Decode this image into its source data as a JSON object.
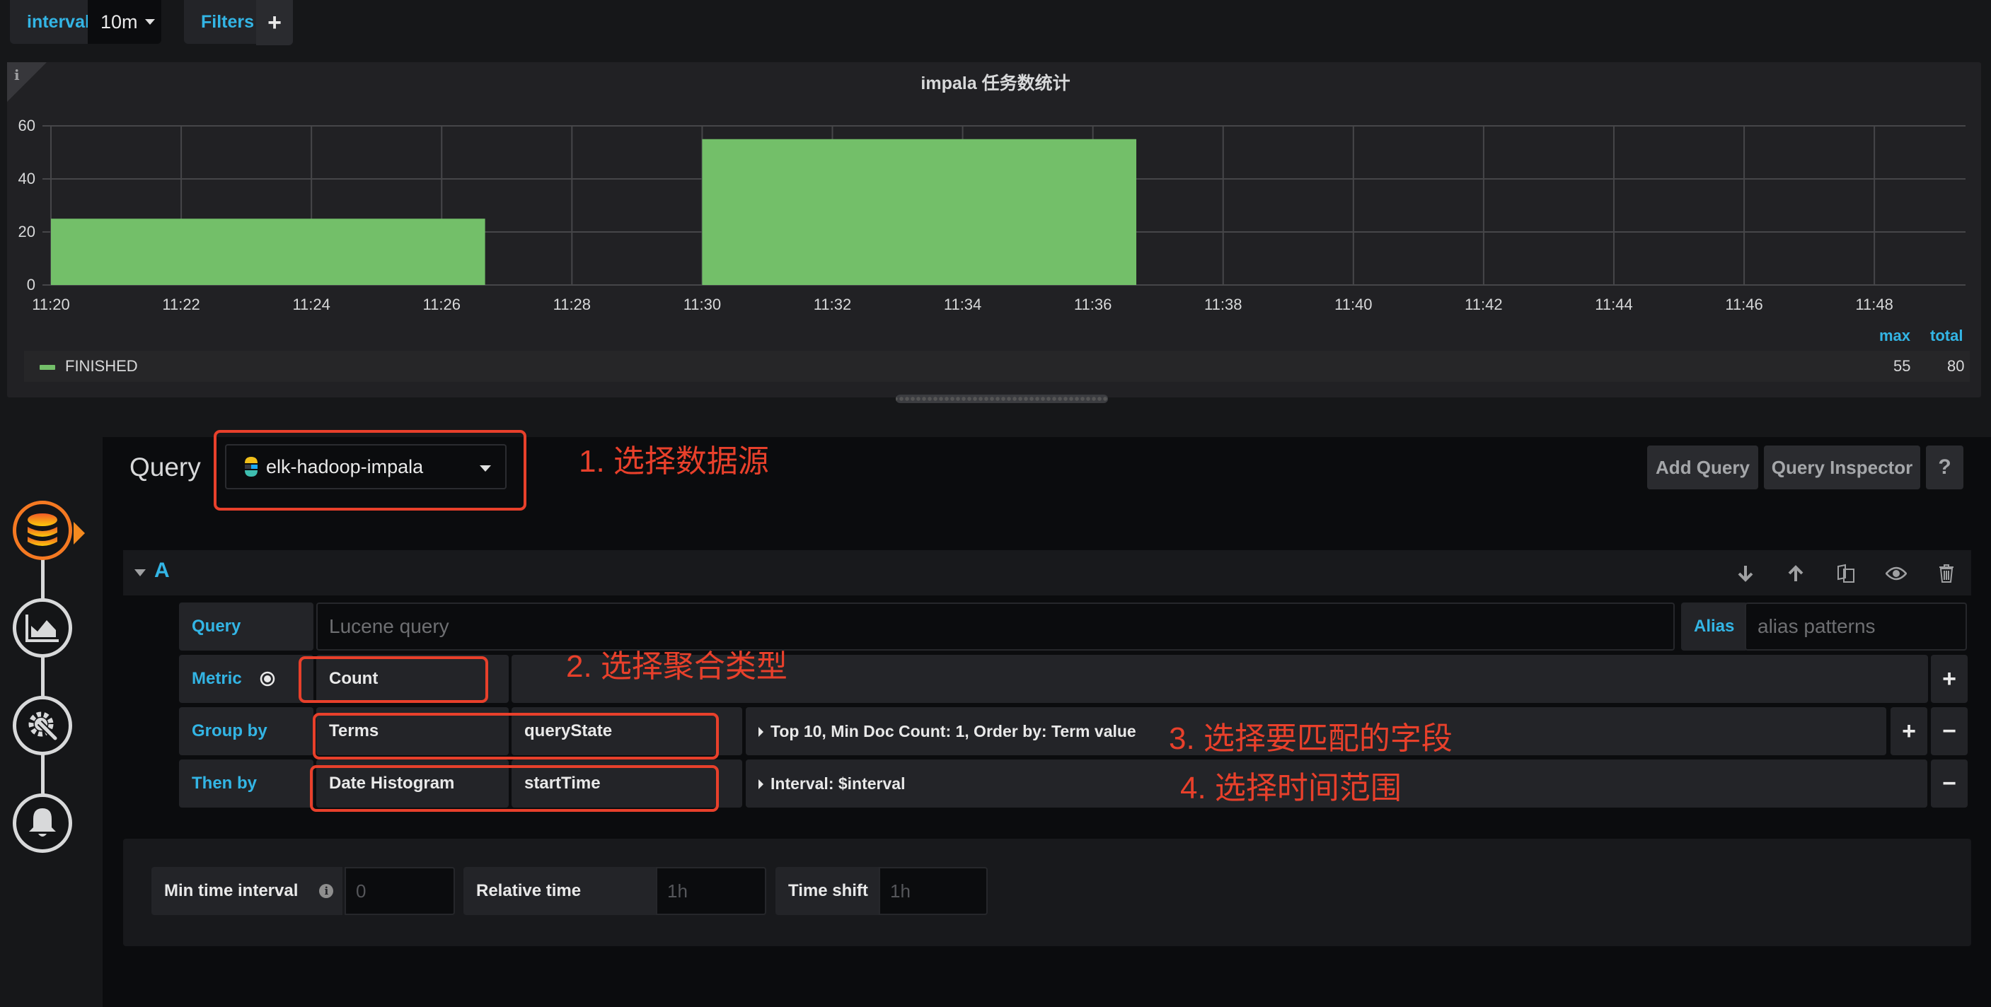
{
  "toolbar": {
    "variable_label": "interval",
    "variable_value": "10m",
    "filters_label": "Filters",
    "add_filter_icon": "plus-icon"
  },
  "panel": {
    "info_icon": "i",
    "title": "impala 任务数统计",
    "legend": {
      "columns": [
        "max",
        "total"
      ],
      "series": [
        {
          "name": "FINISHED",
          "color": "#73bf69",
          "max": "55",
          "total": "80"
        }
      ]
    }
  },
  "chart_data": {
    "type": "bar",
    "title": "impala 任务数统计",
    "xlabel": "",
    "ylabel": "",
    "x_ticks": [
      "11:20",
      "11:22",
      "11:24",
      "11:26",
      "11:28",
      "11:30",
      "11:32",
      "11:34",
      "11:36",
      "11:38",
      "11:40",
      "11:42",
      "11:44",
      "11:46",
      "11:48"
    ],
    "y_ticks": [
      "0",
      "20",
      "40",
      "60"
    ],
    "ylim": [
      0,
      60
    ],
    "xlim_minutes": [
      0,
      29.4
    ],
    "grid": true,
    "legend_position": "bottom",
    "series": [
      {
        "name": "FINISHED",
        "color": "#73bf69",
        "points": [
          {
            "start": "11:20",
            "end": "11:26:40",
            "value": 25
          },
          {
            "start": "11:30",
            "end": "11:36:40",
            "value": 55
          }
        ]
      }
    ]
  },
  "editor": {
    "query_label": "Query",
    "datasource": "elk-hadoop-impala",
    "buttons": {
      "add_query": "Add Query",
      "query_inspector": "Query Inspector",
      "help": "?"
    },
    "sidebar": [
      {
        "name": "queries",
        "icon": "database-icon",
        "active": true
      },
      {
        "name": "visualization",
        "icon": "chart-area-icon",
        "active": false
      },
      {
        "name": "general",
        "icon": "gear-wrench-icon",
        "active": false
      },
      {
        "name": "alert",
        "icon": "bell-icon",
        "active": false
      }
    ],
    "query_row": {
      "ref_id": "A",
      "query_label": "Query",
      "query_placeholder": "Lucene query",
      "alias_label": "Alias",
      "alias_placeholder": "alias patterns",
      "metric_label": "Metric",
      "metric_value": "Count",
      "group_by_label": "Group by",
      "group_by_type": "Terms",
      "group_by_field": "queryState",
      "group_by_options": "Top 10, Min Doc Count: 1, Order by: Term value",
      "then_by_label": "Then by",
      "then_by_type": "Date Histogram",
      "then_by_field": "startTime",
      "then_by_options": "Interval: $interval"
    },
    "options": {
      "min_time_interval_label": "Min time interval",
      "min_time_interval_placeholder": "0",
      "relative_time_label": "Relative time",
      "relative_time_placeholder": "1h",
      "time_shift_label": "Time shift",
      "time_shift_placeholder": "1h"
    }
  },
  "annotations": {
    "step1": "1. 选择数据源",
    "step2": "2. 选择聚合类型",
    "step3": "3. 选择要匹配的字段",
    "step4": "4. 选择时间范围",
    "color": "#e8402b"
  }
}
